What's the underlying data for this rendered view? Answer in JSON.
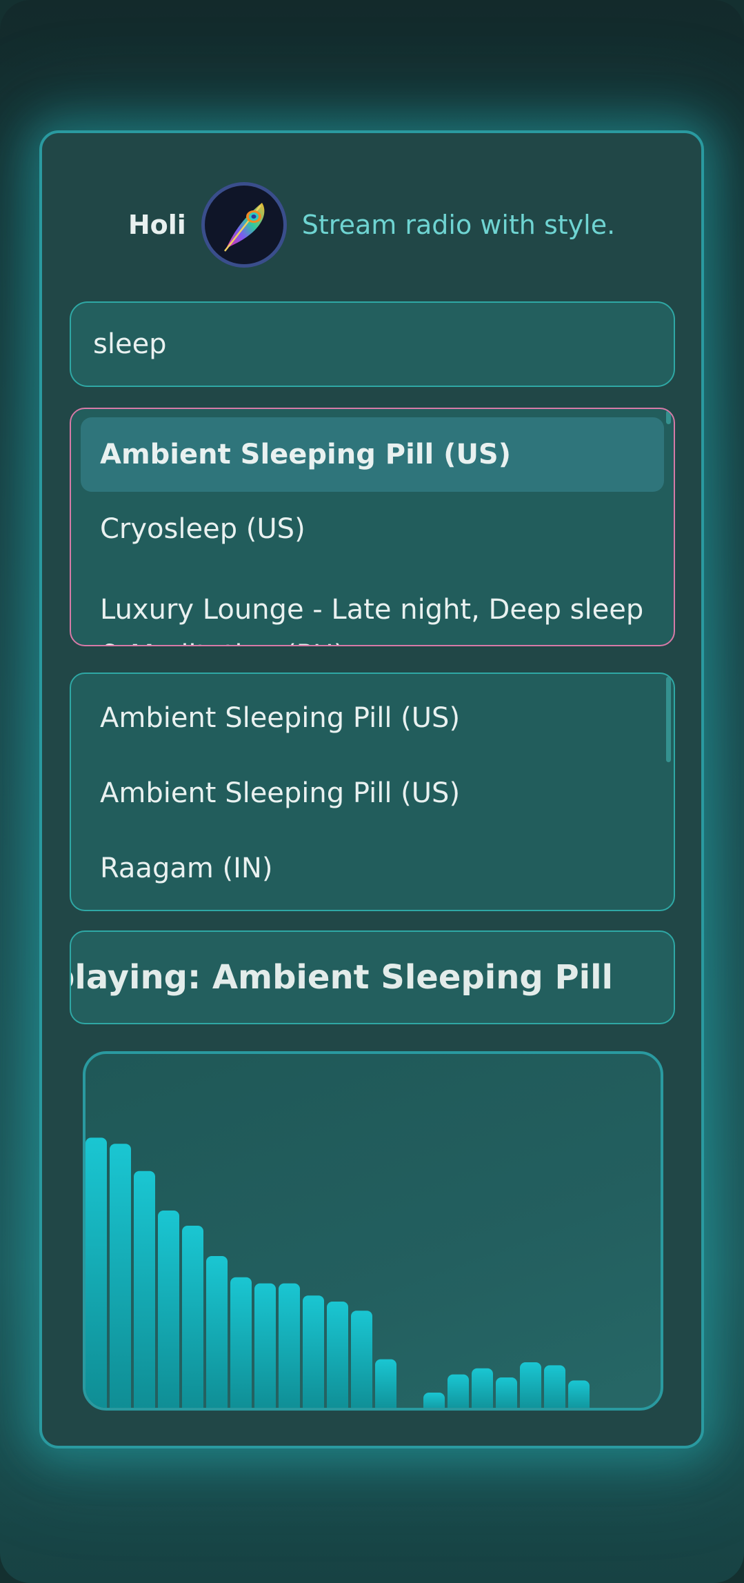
{
  "header": {
    "app_name": "Holi",
    "logo_icon": "peacock-feather-icon",
    "tagline": "Stream radio with style."
  },
  "search": {
    "value": "sleep",
    "placeholder": ""
  },
  "suggestions": [
    {
      "label": "Ambient Sleeping Pill (US)",
      "highlighted": true
    },
    {
      "label": "Cryosleep (US)",
      "highlighted": false
    },
    {
      "label": "Luxury Lounge - Late night, Deep sleep & Meditation (PH)",
      "highlighted": false
    }
  ],
  "recent": [
    {
      "label": "Ambient Sleeping Pill (US)"
    },
    {
      "label": "Ambient Sleeping Pill (US)"
    },
    {
      "label": "Raagam (IN)"
    }
  ],
  "now_playing": {
    "text": "Now playing: Ambient Sleeping Pill"
  },
  "visualizer": {
    "levels": [
      0.89,
      0.87,
      0.78,
      0.65,
      0.6,
      0.5,
      0.43,
      0.41,
      0.41,
      0.37,
      0.35,
      0.32,
      0.16,
      0.0,
      0.05,
      0.11,
      0.13,
      0.1,
      0.15,
      0.14,
      0.09
    ],
    "color": "#17b9c5"
  },
  "colors": {
    "accent": "#2a9aa0",
    "highlight_border": "#d77aa7",
    "tagline": "#6fd4d2"
  }
}
